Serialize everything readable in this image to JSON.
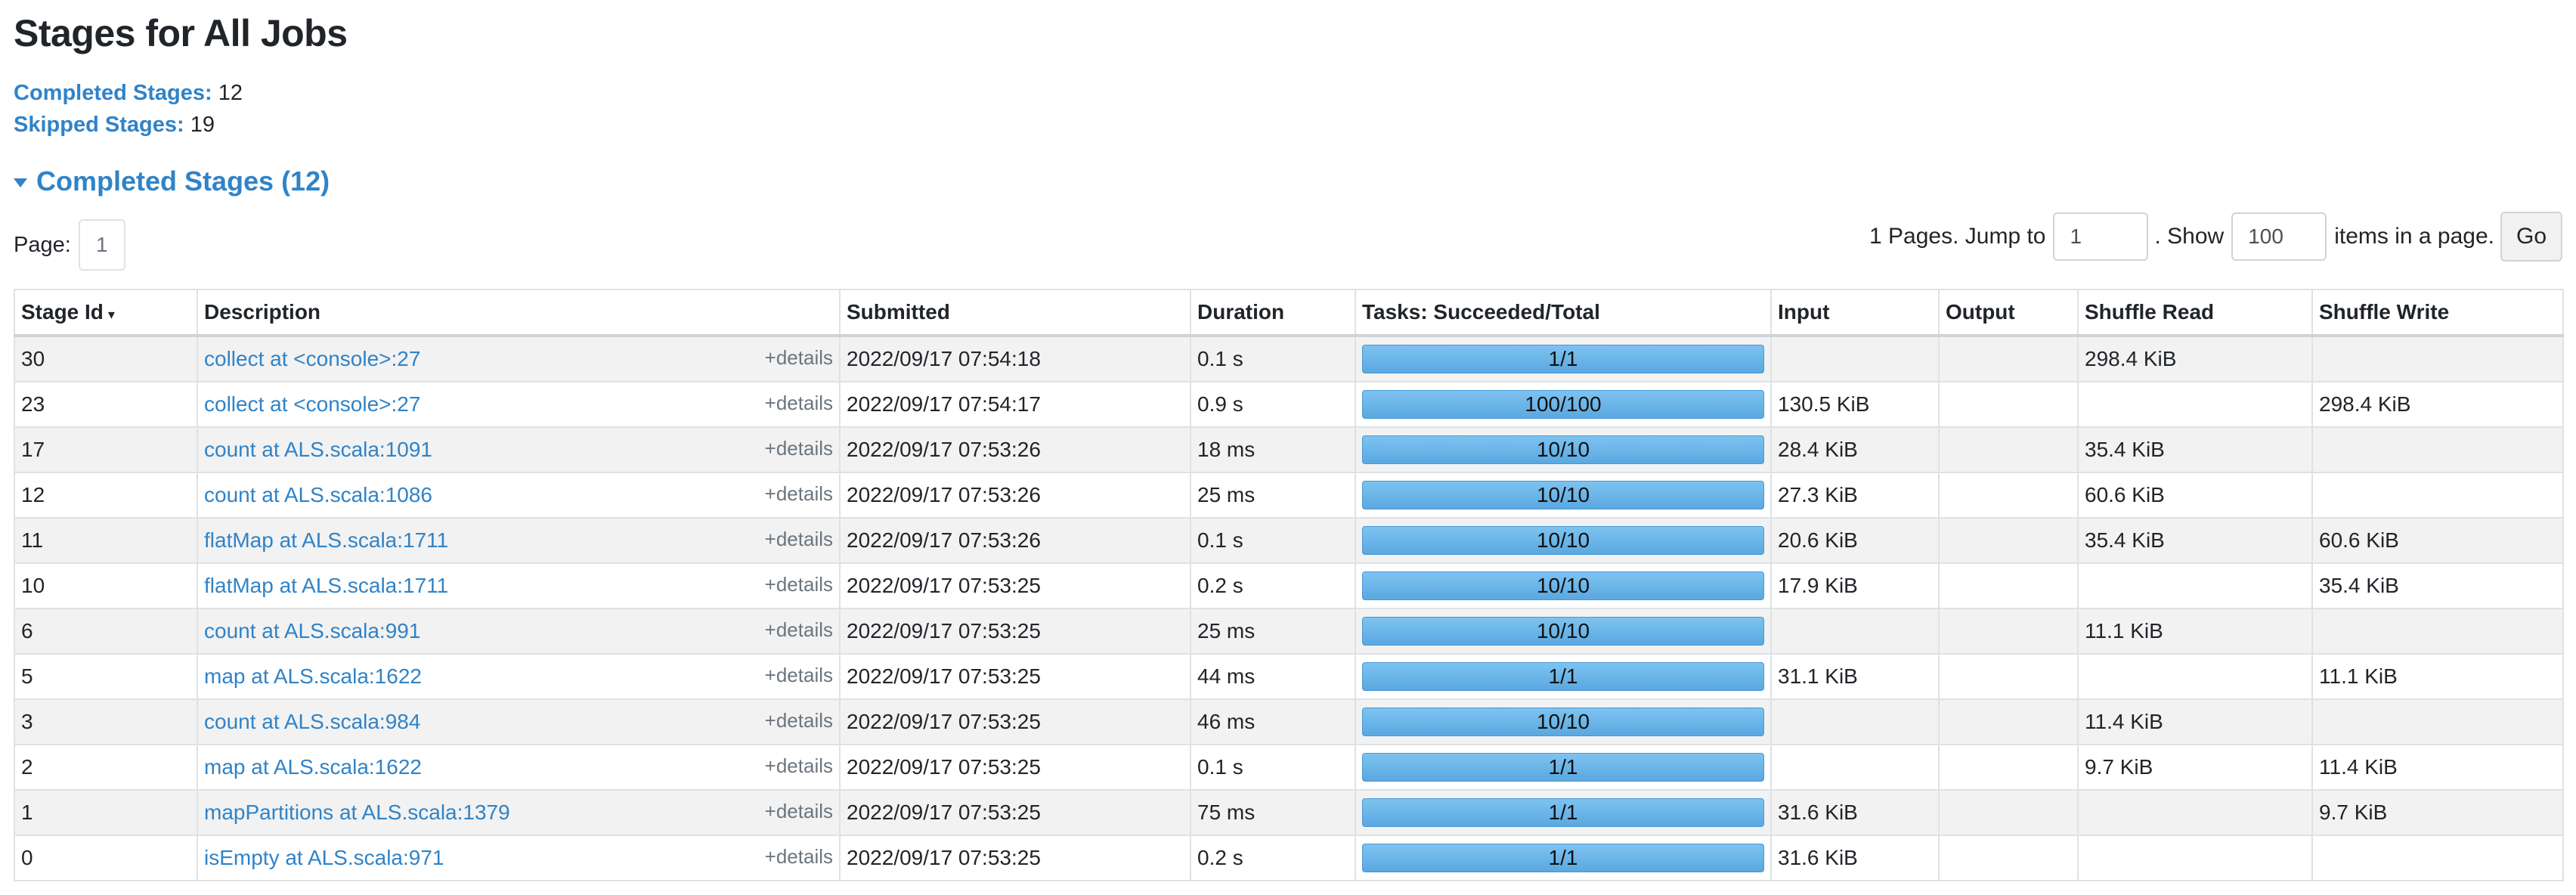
{
  "page_title": "Stages for All Jobs",
  "summary": {
    "completed_label": "Completed Stages:",
    "completed_value": "12",
    "skipped_label": "Skipped Stages:",
    "skipped_value": "19"
  },
  "section_title": "Completed Stages (12)",
  "pager": {
    "page_label": "Page:",
    "page_value": "1",
    "pages_text": "1 Pages. Jump to",
    "jump_value": "1",
    "show_text": ". Show",
    "show_value": "100",
    "items_text": "items in a page.",
    "go_label": "Go"
  },
  "columns": [
    "Stage Id",
    "Description",
    "Submitted",
    "Duration",
    "Tasks: Succeeded/Total",
    "Input",
    "Output",
    "Shuffle Read",
    "Shuffle Write"
  ],
  "sort_indicator": "▾",
  "details_label": "+details",
  "rows": [
    {
      "id": "30",
      "desc": "collect at <console>:27",
      "submitted": "2022/09/17 07:54:18",
      "duration": "0.1 s",
      "tasks": "1/1",
      "input": "",
      "output": "",
      "shuffle_read": "298.4 KiB",
      "shuffle_write": ""
    },
    {
      "id": "23",
      "desc": "collect at <console>:27",
      "submitted": "2022/09/17 07:54:17",
      "duration": "0.9 s",
      "tasks": "100/100",
      "input": "130.5 KiB",
      "output": "",
      "shuffle_read": "",
      "shuffle_write": "298.4 KiB"
    },
    {
      "id": "17",
      "desc": "count at ALS.scala:1091",
      "submitted": "2022/09/17 07:53:26",
      "duration": "18 ms",
      "tasks": "10/10",
      "input": "28.4 KiB",
      "output": "",
      "shuffle_read": "35.4 KiB",
      "shuffle_write": ""
    },
    {
      "id": "12",
      "desc": "count at ALS.scala:1086",
      "submitted": "2022/09/17 07:53:26",
      "duration": "25 ms",
      "tasks": "10/10",
      "input": "27.3 KiB",
      "output": "",
      "shuffle_read": "60.6 KiB",
      "shuffle_write": ""
    },
    {
      "id": "11",
      "desc": "flatMap at ALS.scala:1711",
      "submitted": "2022/09/17 07:53:26",
      "duration": "0.1 s",
      "tasks": "10/10",
      "input": "20.6 KiB",
      "output": "",
      "shuffle_read": "35.4 KiB",
      "shuffle_write": "60.6 KiB"
    },
    {
      "id": "10",
      "desc": "flatMap at ALS.scala:1711",
      "submitted": "2022/09/17 07:53:25",
      "duration": "0.2 s",
      "tasks": "10/10",
      "input": "17.9 KiB",
      "output": "",
      "shuffle_read": "",
      "shuffle_write": "35.4 KiB"
    },
    {
      "id": "6",
      "desc": "count at ALS.scala:991",
      "submitted": "2022/09/17 07:53:25",
      "duration": "25 ms",
      "tasks": "10/10",
      "input": "",
      "output": "",
      "shuffle_read": "11.1 KiB",
      "shuffle_write": ""
    },
    {
      "id": "5",
      "desc": "map at ALS.scala:1622",
      "submitted": "2022/09/17 07:53:25",
      "duration": "44 ms",
      "tasks": "1/1",
      "input": "31.1 KiB",
      "output": "",
      "shuffle_read": "",
      "shuffle_write": "11.1 KiB"
    },
    {
      "id": "3",
      "desc": "count at ALS.scala:984",
      "submitted": "2022/09/17 07:53:25",
      "duration": "46 ms",
      "tasks": "10/10",
      "input": "",
      "output": "",
      "shuffle_read": "11.4 KiB",
      "shuffle_write": ""
    },
    {
      "id": "2",
      "desc": "map at ALS.scala:1622",
      "submitted": "2022/09/17 07:53:25",
      "duration": "0.1 s",
      "tasks": "1/1",
      "input": "",
      "output": "",
      "shuffle_read": "9.7 KiB",
      "shuffle_write": "11.4 KiB"
    },
    {
      "id": "1",
      "desc": "mapPartitions at ALS.scala:1379",
      "submitted": "2022/09/17 07:53:25",
      "duration": "75 ms",
      "tasks": "1/1",
      "input": "31.6 KiB",
      "output": "",
      "shuffle_read": "",
      "shuffle_write": "9.7 KiB"
    },
    {
      "id": "0",
      "desc": "isEmpty at ALS.scala:971",
      "submitted": "2022/09/17 07:53:25",
      "duration": "0.2 s",
      "tasks": "1/1",
      "input": "31.6 KiB",
      "output": "",
      "shuffle_read": "",
      "shuffle_write": ""
    }
  ]
}
